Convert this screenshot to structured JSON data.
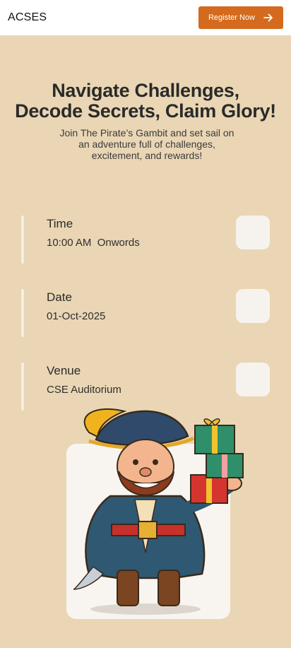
{
  "header": {
    "brand": "ACSES",
    "register_label": "Register Now"
  },
  "hero": {
    "title_line1": "Navigate Challenges,",
    "title_line2": "Decode Secrets, Claim Glory!",
    "subtitle": "Join The Pirate’s Gambit and set sail on an adventure full of challenges, excitement, and rewards!"
  },
  "details": [
    {
      "label": "Time",
      "value": "10:00 AM  Onwords"
    },
    {
      "label": "Date",
      "value": "01-Oct-2025"
    },
    {
      "label": "Venue",
      "value": "CSE Auditorium"
    }
  ],
  "colors": {
    "background": "#ead6b4",
    "accent": "#d46a1e",
    "header_bg": "#ffffff"
  },
  "icons": {
    "register_arrow": "arrow-right-icon",
    "mascot": "pirate-mascot-illustration"
  }
}
